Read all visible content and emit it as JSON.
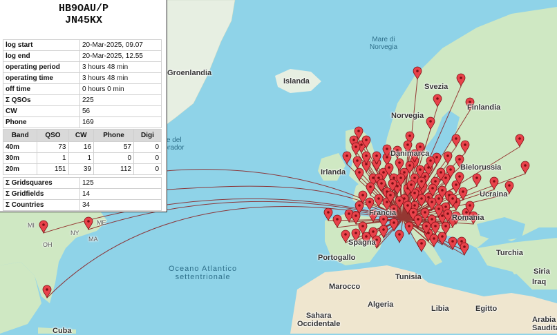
{
  "station": {
    "callsign": "HB9OAU/P",
    "locator": "JN45KX"
  },
  "log": [
    {
      "label": "log start",
      "value": "20-Mar-2025, 09.07"
    },
    {
      "label": "log end",
      "value": "20-Mar-2025, 12.55"
    },
    {
      "label": "operating period",
      "value": "3 hours 48 min"
    },
    {
      "label": "operating time",
      "value": "3 hours 48 min"
    },
    {
      "label": "off time",
      "value": "0 hours 0 min"
    },
    {
      "label": "Σ QSOs",
      "value": "225"
    },
    {
      "label": "CW",
      "value": "56"
    },
    {
      "label": "Phone",
      "value": "169"
    }
  ],
  "bands": {
    "headers": [
      "Band",
      "QSO",
      "CW",
      "Phone",
      "Digi"
    ],
    "rows": [
      [
        "40m",
        "73",
        "16",
        "57",
        "0"
      ],
      [
        "30m",
        "1",
        "1",
        "0",
        "0"
      ],
      [
        "20m",
        "151",
        "39",
        "112",
        "0"
      ]
    ]
  },
  "summary": [
    {
      "label": "Σ Gridsquares",
      "value": "125"
    },
    {
      "label": "Σ Gridfields",
      "value": "14"
    },
    {
      "label": "Σ Countries",
      "value": "34"
    }
  ],
  "map_labels": {
    "groenlandia": "Groenlandia",
    "islanda": "Islanda",
    "mare_norvegia": "Mare di\nNorvegia",
    "svezia": "Svezia",
    "norvegia": "Norvegia",
    "finlandia": "Finlandia",
    "danimarca": "Danimarca",
    "irlanda": "Irlanda",
    "bielorussia": "Bielorussia",
    "ucraina": "Ucraina",
    "francia": "Francia",
    "romania": "Romania",
    "spagna": "Spagna",
    "portogallo": "Portogallo",
    "turchia": "Turchia",
    "siria": "Siria",
    "iraq": "Iraq",
    "tunisia": "Tunisia",
    "marocco": "Marocco",
    "algeria": "Algeria",
    "libia": "Libia",
    "egitto": "Egitto",
    "sahara": "Sahara\nOccidentale",
    "arabia": "Arabia\nSaudita",
    "cuba": "Cuba",
    "oceano": "Oceano Atlantico\nsettentrionale",
    "labrador": "are del\nabrador",
    "ny": "NY",
    "oh": "OH",
    "me": "ME",
    "ma": "MA",
    "mi": "MI"
  },
  "colors": {
    "sea": "#8fd3e8",
    "land": "#cfe8c3",
    "land_north": "#e7efe2",
    "desert": "#efe6cf",
    "marker": "#e8424a",
    "path": "#8b1a1a"
  },
  "home_icon": "map-pin-icon"
}
